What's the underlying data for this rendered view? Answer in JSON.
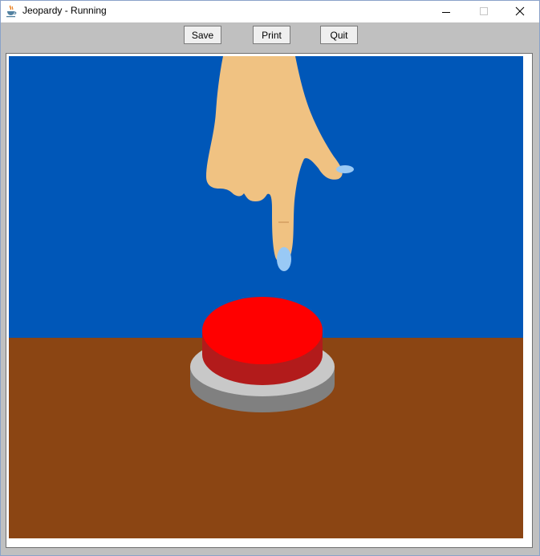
{
  "window": {
    "title": "Jeopardy - Running",
    "icon": "java-cup-icon"
  },
  "toolbar": {
    "save_label": "Save",
    "print_label": "Print",
    "quit_label": "Quit"
  },
  "scene": {
    "sky_color": "#0057b8",
    "table_color": "#8b4513",
    "button_top_color": "#ff0000",
    "button_side_color": "#b21b1b",
    "base_top_color": "#c8c8c8",
    "base_side_color": "#808080",
    "skin_color": "#f0c282",
    "nail_color": "#99c9f5"
  }
}
